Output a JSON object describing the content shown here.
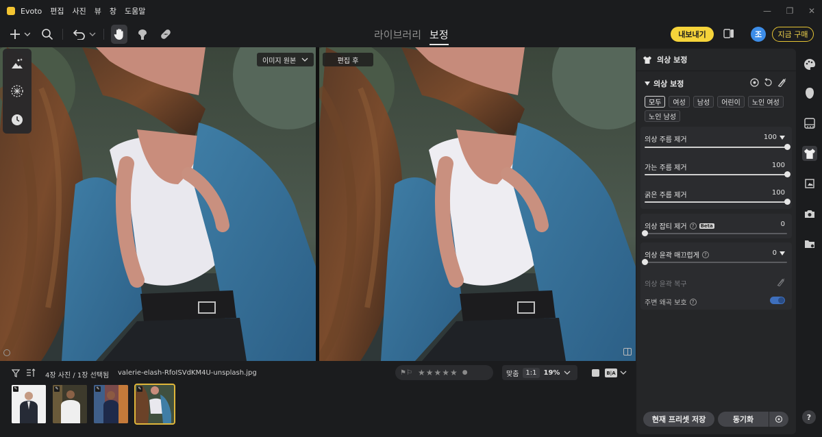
{
  "app": {
    "name": "Evoto",
    "menu": [
      "편집",
      "사진",
      "뷰",
      "창",
      "도움말"
    ]
  },
  "toolbar": {
    "mode_tabs": [
      "라이브러리",
      "보정"
    ],
    "active_mode": "보정",
    "export_label": "내보내기",
    "avatar_initial": "조",
    "buy_label": "지금 구매"
  },
  "canvas": {
    "before_label": "이미지 원본",
    "after_label": "편집 후"
  },
  "panel": {
    "header": "의상 보정",
    "section_title": "의상 보정",
    "chips": [
      "모두",
      "여성",
      "남성",
      "어린이",
      "노인 여성",
      "노인 남성"
    ],
    "active_chip": "모두",
    "sliders": [
      {
        "label": "의상 주름 제거",
        "value": 100,
        "has_dropdown": true
      },
      {
        "label": "가는 주름 제거",
        "value": 100
      },
      {
        "label": "굵은 주름 제거",
        "value": 100
      },
      {
        "label": "의상 잡티 제거",
        "value": 0,
        "has_help": true,
        "badge": "Beta"
      },
      {
        "label": "의상 윤곽 매끄럽게",
        "value": 0,
        "has_help": true,
        "has_dropdown": true
      }
    ],
    "restore_label": "의상 윤곽 복구",
    "protect_label": "주변 왜곡 보호",
    "protect_on": true,
    "save_preset_label": "현재 프리셋 저장",
    "sync_label": "동기화"
  },
  "filmstrip": {
    "count_text": "4장 사진 / 1장 선택됨",
    "filename": "valerie-elash-RfoISVdKM4U-unsplash.jpg",
    "zoom_fit": "맞춤",
    "zoom_ratio": "1:1",
    "zoom_percent": "19%",
    "compare_label": "B|A",
    "selected_index": 3
  }
}
